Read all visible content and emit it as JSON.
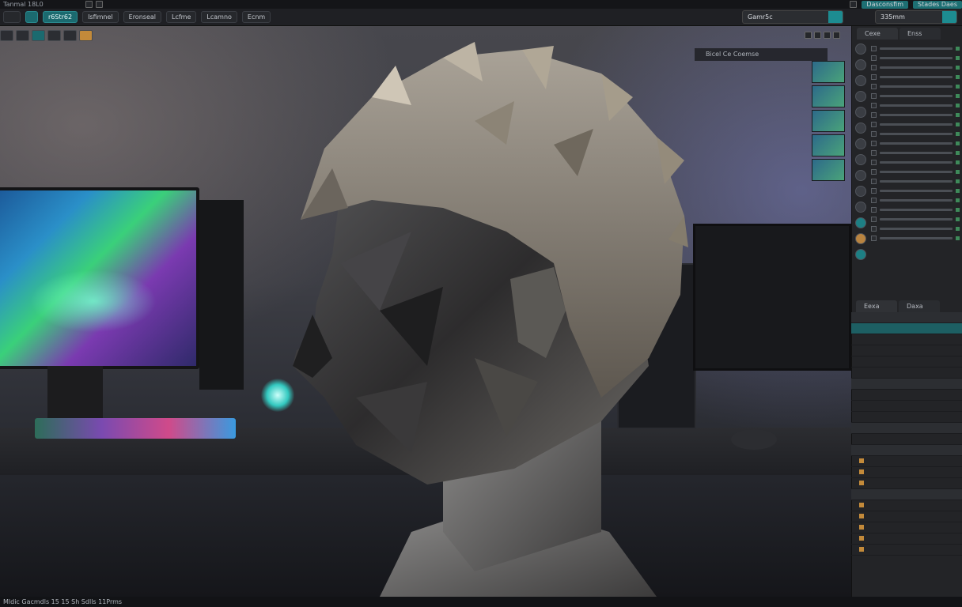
{
  "menu": [
    "Tanmal 18L0"
  ],
  "top_right": {
    "workspace": "Dasconsfim",
    "scene": "Stades Daes"
  },
  "toolbar": {
    "buttons": [
      "r6Str62",
      "Isfimnel",
      "Eronseal",
      "Lcfme",
      "Lcamno",
      "Ecnm"
    ]
  },
  "search": {
    "left_value": "Gamr5c",
    "right_value": "335mm"
  },
  "viewport": {
    "mini_outliner": "Bicel Ce Coemse"
  },
  "rpanel": {
    "tabs": [
      "Cexe",
      "Enss"
    ],
    "tabs2": [
      "Eexa",
      "Daxa"
    ]
  },
  "status_text": "Mldic Gacmdls 15 15 Sh Sdlls 11Prms",
  "colors": {
    "accent": "#1d8c91",
    "orange": "#c38a3a",
    "bg": "#1b1c1f"
  },
  "icons": [
    "cursor-icon",
    "move-icon",
    "rotate-icon",
    "scale-icon",
    "camera-icon",
    "light-icon"
  ]
}
